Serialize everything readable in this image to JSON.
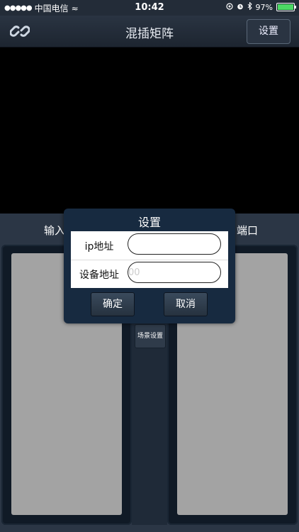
{
  "status_bar": {
    "signal_dots": "●●●●●",
    "carrier": "中国电信",
    "wifi_glyph": "≈",
    "time": "10:42",
    "icons": [
      "location-icon",
      "alarm-icon",
      "bluetooth-icon"
    ],
    "battery_text": "97%",
    "battery_level": 0.97
  },
  "navbar": {
    "title": "混插矩阵",
    "left_icon": "link-icon",
    "settings_label": "设置"
  },
  "main": {
    "input_label": "输入",
    "output_label": "端口",
    "scene_button": "场景设置"
  },
  "dialog": {
    "title": "设置",
    "fields": [
      {
        "label": "ip地址",
        "value": "",
        "placeholder": ""
      },
      {
        "label": "设备地址",
        "value": "",
        "placeholder": "00"
      }
    ],
    "ok_label": "确定",
    "cancel_label": "取消"
  },
  "colors": {
    "nav_bg": "#1d2530",
    "video_bg": "#000000",
    "dialog_bg": "#172a40",
    "panel_inner": "#a3a3a3"
  }
}
